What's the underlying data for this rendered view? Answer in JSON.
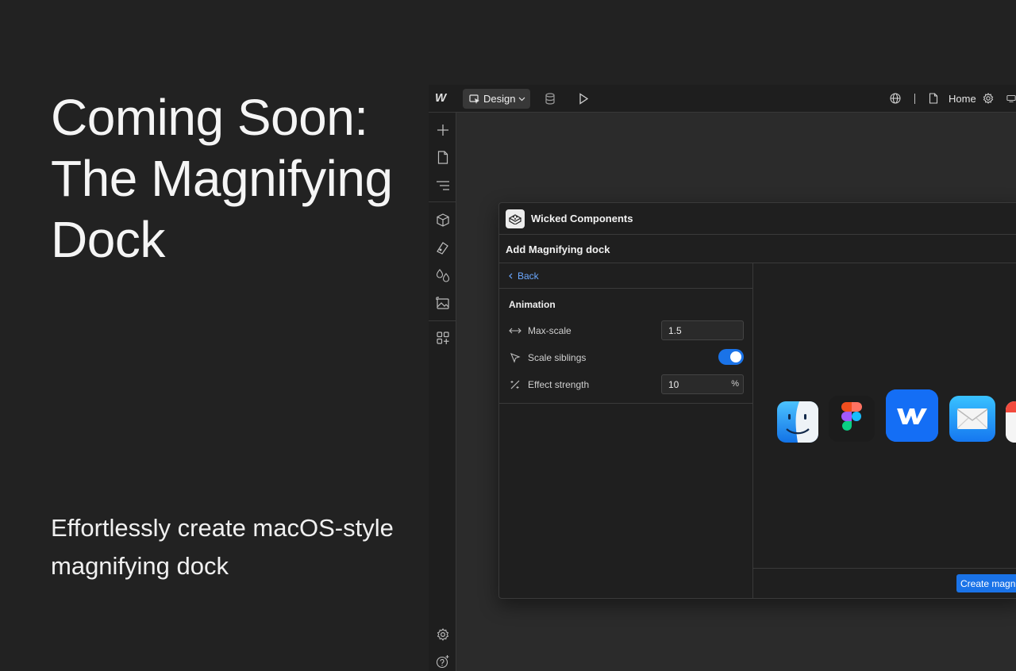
{
  "hero": {
    "title": "Coming Soon: The Magnifying Dock",
    "subtitle": "Effortlessly create macOS-style magnifying dock"
  },
  "designer": {
    "logo": "W",
    "mode_label": "Design",
    "page_name": "Home",
    "topbar_icons": [
      "cursor-icon",
      "chevron-down-icon",
      "database-icon",
      "play-icon",
      "globe-icon",
      "page-icon",
      "gear-icon",
      "device-icon"
    ],
    "sidebar_icons": [
      "plus-icon",
      "page-icon",
      "navigator-icon",
      "component-icon",
      "style-icon",
      "color-icon",
      "image-icon",
      "apps-icon",
      "settings-icon",
      "help-icon"
    ]
  },
  "panel": {
    "brand": "Wicked Components",
    "title": "Add Magnifying dock",
    "back_label": "Back",
    "section": "Animation",
    "max_scale": {
      "label": "Max-scale",
      "value": "1.5"
    },
    "scale_siblings": {
      "label": "Scale siblings",
      "on": true
    },
    "effect_strength": {
      "label": "Effect strength",
      "value": "10",
      "unit": "%"
    },
    "dock_apps": [
      "finder-icon",
      "figma-icon",
      "webflow-icon",
      "mail-icon",
      "calendar-icon"
    ],
    "create_button": "Create magni"
  },
  "colors": {
    "background": "#222222",
    "accent": "#1a73e8",
    "link": "#6ba8ff"
  }
}
